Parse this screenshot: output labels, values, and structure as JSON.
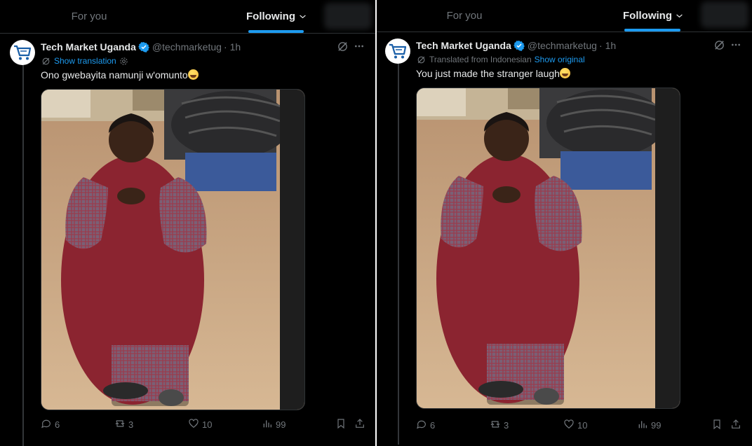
{
  "left": {
    "tabs": {
      "for_you": "For you",
      "following": "Following"
    },
    "post": {
      "display_name": "Tech Market Uganda",
      "handle": "@techmarketug",
      "separator": "·",
      "time": "1h",
      "translation_link": "Show translation",
      "text": "Ono gwebayita namunji w'omunto",
      "stats": {
        "replies": "6",
        "reposts": "3",
        "likes": "10",
        "views": "99"
      }
    }
  },
  "right": {
    "tabs": {
      "for_you": "For you",
      "following": "Following"
    },
    "post": {
      "display_name": "Tech Market Uganda",
      "handle": "@techmarketug",
      "separator": "·",
      "time": "1h",
      "translated_note": "Translated from Indonesian",
      "show_original": "Show original",
      "text": "You just made the stranger laugh",
      "stats": {
        "replies": "6",
        "reposts": "3",
        "likes": "10",
        "views": "99"
      }
    }
  },
  "colors": {
    "background": "#000000",
    "text_primary": "#e7e9ea",
    "text_secondary": "#71767b",
    "accent": "#1d9bf0",
    "divider": "#2f3336"
  },
  "icons": {
    "emoji": "face-with-tears-of-joy",
    "verified": "verified-badge-icon",
    "grok": "grok-icon",
    "more": "more-icon",
    "reply": "reply-icon",
    "repost": "repost-icon",
    "like": "like-icon",
    "views": "views-icon",
    "bookmark": "bookmark-icon",
    "share": "share-icon"
  }
}
